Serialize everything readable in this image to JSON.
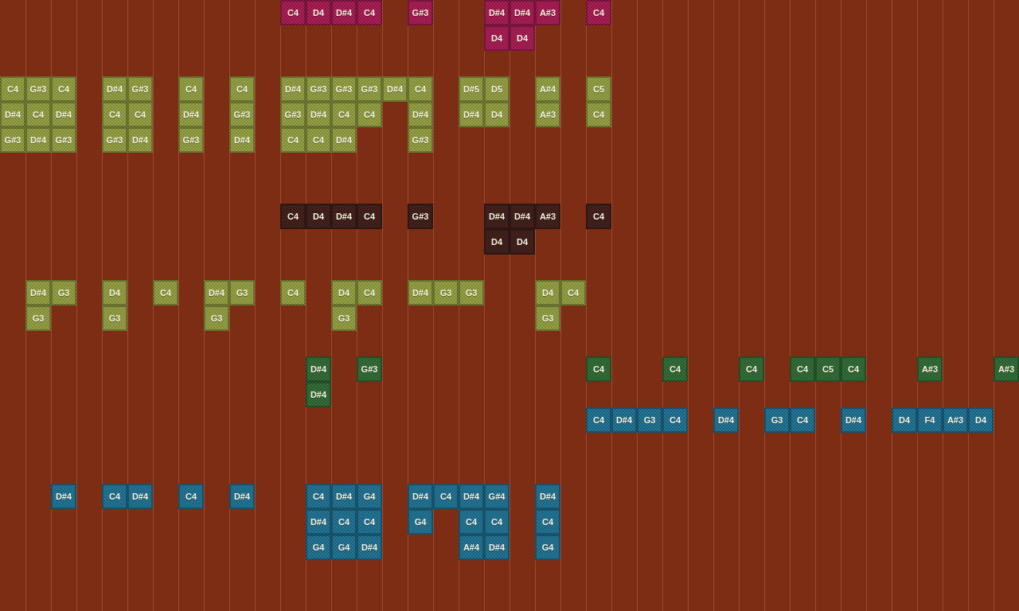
{
  "tracks": [
    {
      "color": "#a3164e",
      "steps": [
        {
          "kind": "rest"
        },
        {
          "kind": "rest"
        },
        {
          "kind": "rest"
        },
        {
          "kind": "rest"
        },
        {
          "kind": "rest"
        },
        {
          "kind": "rest"
        },
        {
          "kind": "rest"
        },
        {
          "kind": "rest"
        },
        {
          "kind": "rest"
        },
        {
          "kind": "rest"
        },
        {
          "kind": "rest"
        },
        {
          "kind": "chord",
          "notes": [
            "C4"
          ]
        },
        {
          "kind": "chord",
          "notes": [
            "D4"
          ]
        },
        {
          "kind": "chord",
          "notes": [
            "D#4"
          ]
        },
        {
          "kind": "chord",
          "notes": [
            "C4"
          ]
        },
        {
          "kind": "rest"
        },
        {
          "kind": "chord",
          "notes": [
            "G#3"
          ]
        },
        {
          "kind": "rest"
        },
        {
          "kind": "rest"
        },
        {
          "kind": "chord",
          "notes": [
            "D#4",
            "D4"
          ]
        },
        {
          "kind": "chord",
          "notes": [
            "D#4",
            "D4"
          ]
        },
        {
          "kind": "chord",
          "notes": [
            "A#3"
          ]
        },
        {
          "kind": "rest"
        },
        {
          "kind": "chord",
          "notes": [
            "C4"
          ]
        }
      ]
    },
    {
      "color": "#8e9b3d",
      "steps": [
        {
          "kind": "chord",
          "notes": [
            "C4",
            "D#4",
            "G#3"
          ]
        },
        {
          "kind": "chord",
          "notes": [
            "G#3",
            "C4",
            "D#4"
          ]
        },
        {
          "kind": "chord",
          "notes": [
            "C4",
            "D#4",
            "G#3"
          ]
        },
        {
          "kind": "rest"
        },
        {
          "kind": "chord",
          "notes": [
            "D#4",
            "C4",
            "G#3"
          ]
        },
        {
          "kind": "chord",
          "notes": [
            "G#3",
            "C4",
            "D#4"
          ]
        },
        {
          "kind": "rest"
        },
        {
          "kind": "chord",
          "notes": [
            "C4",
            "D#4",
            "G#3"
          ]
        },
        {
          "kind": "rest"
        },
        {
          "kind": "chord",
          "notes": [
            "C4",
            "G#3",
            "D#4"
          ]
        },
        {
          "kind": "rest"
        },
        {
          "kind": "chord",
          "notes": [
            "D#4",
            "G#3",
            "C4"
          ]
        },
        {
          "kind": "chord",
          "notes": [
            "G#3",
            "D#4",
            "C4"
          ]
        },
        {
          "kind": "chord",
          "notes": [
            "G#3",
            "C4",
            "D#4"
          ]
        },
        {
          "kind": "chord",
          "notes": [
            "G#3",
            "C4"
          ]
        },
        {
          "kind": "chord",
          "notes": [
            "D#4"
          ]
        },
        {
          "kind": "chord",
          "notes": [
            "C4",
            "D#4",
            "G#3"
          ]
        },
        {
          "kind": "rest"
        },
        {
          "kind": "chord",
          "notes": [
            "D#5",
            "D#4"
          ]
        },
        {
          "kind": "chord",
          "notes": [
            "D5",
            "D4"
          ]
        },
        {
          "kind": "rest"
        },
        {
          "kind": "chord",
          "notes": [
            "A#4",
            "A#3"
          ]
        },
        {
          "kind": "rest"
        },
        {
          "kind": "chord",
          "notes": [
            "C5",
            "C4"
          ]
        }
      ]
    },
    {
      "color": "#3b1914",
      "steps": [
        {
          "kind": "rest"
        },
        {
          "kind": "rest"
        },
        {
          "kind": "rest"
        },
        {
          "kind": "rest"
        },
        {
          "kind": "rest"
        },
        {
          "kind": "rest"
        },
        {
          "kind": "rest"
        },
        {
          "kind": "rest"
        },
        {
          "kind": "rest"
        },
        {
          "kind": "rest"
        },
        {
          "kind": "rest"
        },
        {
          "kind": "chord",
          "notes": [
            "C4"
          ]
        },
        {
          "kind": "chord",
          "notes": [
            "D4"
          ]
        },
        {
          "kind": "chord",
          "notes": [
            "D#4"
          ]
        },
        {
          "kind": "chord",
          "notes": [
            "C4"
          ]
        },
        {
          "kind": "rest"
        },
        {
          "kind": "chord",
          "notes": [
            "G#3"
          ]
        },
        {
          "kind": "rest"
        },
        {
          "kind": "rest"
        },
        {
          "kind": "chord",
          "notes": [
            "D#4",
            "D4"
          ]
        },
        {
          "kind": "chord",
          "notes": [
            "D#4",
            "D4"
          ]
        },
        {
          "kind": "chord",
          "notes": [
            "A#3"
          ]
        },
        {
          "kind": "rest"
        },
        {
          "kind": "chord",
          "notes": [
            "C4"
          ]
        }
      ]
    },
    {
      "color": "#8e9b3d",
      "steps": [
        {
          "kind": "rest"
        },
        {
          "kind": "chord",
          "notes": [
            "D#4",
            "G3"
          ]
        },
        {
          "kind": "chord",
          "notes": [
            "G3"
          ]
        },
        {
          "kind": "rest"
        },
        {
          "kind": "chord",
          "notes": [
            "D4",
            "G3"
          ]
        },
        {
          "kind": "rest"
        },
        {
          "kind": "chord",
          "notes": [
            "C4"
          ]
        },
        {
          "kind": "rest"
        },
        {
          "kind": "chord",
          "notes": [
            "D#4",
            "G3"
          ]
        },
        {
          "kind": "chord",
          "notes": [
            "G3"
          ]
        },
        {
          "kind": "rest"
        },
        {
          "kind": "chord",
          "notes": [
            "C4"
          ]
        },
        {
          "kind": "rest"
        },
        {
          "kind": "chord",
          "notes": [
            "D4",
            "G3"
          ]
        },
        {
          "kind": "chord",
          "notes": [
            "C4"
          ]
        },
        {
          "kind": "rest"
        },
        {
          "kind": "chord",
          "notes": [
            "D#4"
          ]
        },
        {
          "kind": "chord",
          "notes": [
            "G3"
          ]
        },
        {
          "kind": "chord",
          "notes": [
            "G3"
          ]
        },
        {
          "kind": "rest"
        },
        {
          "kind": "rest"
        },
        {
          "kind": "chord",
          "notes": [
            "D4",
            "G3"
          ]
        },
        {
          "kind": "chord",
          "notes": [
            "C4"
          ]
        }
      ]
    },
    {
      "color": "#2c6630",
      "steps": [
        {
          "kind": "rest"
        },
        {
          "kind": "rest"
        },
        {
          "kind": "rest"
        },
        {
          "kind": "rest"
        },
        {
          "kind": "rest"
        },
        {
          "kind": "rest"
        },
        {
          "kind": "rest"
        },
        {
          "kind": "rest"
        },
        {
          "kind": "rest"
        },
        {
          "kind": "rest"
        },
        {
          "kind": "rest"
        },
        {
          "kind": "rest"
        },
        {
          "kind": "chord",
          "notes": [
            "D#4",
            "D#4"
          ]
        },
        {
          "kind": "rest"
        },
        {
          "kind": "chord",
          "notes": [
            "G#3"
          ]
        },
        {
          "kind": "rest"
        },
        {
          "kind": "rest"
        },
        {
          "kind": "rest"
        },
        {
          "kind": "rest"
        },
        {
          "kind": "rest"
        },
        {
          "kind": "rest"
        },
        {
          "kind": "rest"
        },
        {
          "kind": "rest"
        },
        {
          "kind": "chord",
          "notes": [
            "C4"
          ]
        },
        {
          "kind": "rest"
        },
        {
          "kind": "rest"
        },
        {
          "kind": "chord",
          "notes": [
            "C4"
          ]
        },
        {
          "kind": "rest"
        },
        {
          "kind": "rest"
        },
        {
          "kind": "chord",
          "notes": [
            "C4"
          ]
        },
        {
          "kind": "rest"
        },
        {
          "kind": "chord",
          "notes": [
            "C4"
          ]
        },
        {
          "kind": "chord",
          "notes": [
            "C5"
          ]
        },
        {
          "kind": "chord",
          "notes": [
            "C4"
          ]
        },
        {
          "kind": "rest"
        },
        {
          "kind": "rest"
        },
        {
          "kind": "chord",
          "notes": [
            "A#3"
          ]
        },
        {
          "kind": "rest"
        },
        {
          "kind": "rest"
        },
        {
          "kind": "chord",
          "notes": [
            "A#3"
          ]
        }
      ]
    },
    {
      "color": "#1b6d8e",
      "steps": [
        {
          "kind": "rest"
        },
        {
          "kind": "rest"
        },
        {
          "kind": "rest"
        },
        {
          "kind": "rest"
        },
        {
          "kind": "rest"
        },
        {
          "kind": "rest"
        },
        {
          "kind": "rest"
        },
        {
          "kind": "rest"
        },
        {
          "kind": "rest"
        },
        {
          "kind": "rest"
        },
        {
          "kind": "rest"
        },
        {
          "kind": "rest"
        },
        {
          "kind": "rest"
        },
        {
          "kind": "rest"
        },
        {
          "kind": "rest"
        },
        {
          "kind": "rest"
        },
        {
          "kind": "rest"
        },
        {
          "kind": "rest"
        },
        {
          "kind": "rest"
        },
        {
          "kind": "rest"
        },
        {
          "kind": "rest"
        },
        {
          "kind": "rest"
        },
        {
          "kind": "rest"
        },
        {
          "kind": "chord",
          "notes": [
            "C4"
          ]
        },
        {
          "kind": "chord",
          "notes": [
            "D#4"
          ]
        },
        {
          "kind": "chord",
          "notes": [
            "G3"
          ]
        },
        {
          "kind": "chord",
          "notes": [
            "C4"
          ]
        },
        {
          "kind": "rest"
        },
        {
          "kind": "chord",
          "notes": [
            "D#4"
          ]
        },
        {
          "kind": "rest"
        },
        {
          "kind": "chord",
          "notes": [
            "G3"
          ]
        },
        {
          "kind": "chord",
          "notes": [
            "C4"
          ]
        },
        {
          "kind": "rest"
        },
        {
          "kind": "chord",
          "notes": [
            "D#4"
          ]
        },
        {
          "kind": "rest"
        },
        {
          "kind": "chord",
          "notes": [
            "D4"
          ]
        },
        {
          "kind": "chord",
          "notes": [
            "F4"
          ]
        },
        {
          "kind": "chord",
          "notes": [
            "A#3"
          ]
        },
        {
          "kind": "chord",
          "notes": [
            "D4"
          ]
        }
      ]
    },
    {
      "color": "#1b6d8e",
      "steps": [
        {
          "kind": "rest"
        },
        {
          "kind": "rest"
        },
        {
          "kind": "chord",
          "notes": [
            "D#4"
          ]
        },
        {
          "kind": "rest"
        },
        {
          "kind": "chord",
          "notes": [
            "C4"
          ]
        },
        {
          "kind": "chord",
          "notes": [
            "D#4"
          ]
        },
        {
          "kind": "rest"
        },
        {
          "kind": "chord",
          "notes": [
            "C4"
          ]
        },
        {
          "kind": "rest"
        },
        {
          "kind": "chord",
          "notes": [
            "D#4"
          ]
        },
        {
          "kind": "rest"
        },
        {
          "kind": "rest"
        },
        {
          "kind": "chord",
          "notes": [
            "C4",
            "D#4",
            "G4"
          ]
        },
        {
          "kind": "chord",
          "notes": [
            "D#4",
            "C4",
            "G4"
          ]
        },
        {
          "kind": "chord",
          "notes": [
            "G4",
            "C4",
            "D#4"
          ]
        },
        {
          "kind": "rest"
        },
        {
          "kind": "chord",
          "notes": [
            "D#4",
            "G4"
          ]
        },
        {
          "kind": "chord",
          "notes": [
            "C4"
          ]
        },
        {
          "kind": "chord",
          "notes": [
            "D#4",
            "C4",
            "A#4"
          ]
        },
        {
          "kind": "chord",
          "notes": [
            "G#4",
            "C4",
            "D#4"
          ]
        },
        {
          "kind": "rest"
        },
        {
          "kind": "chord",
          "notes": [
            "D#4",
            "C4",
            "G4"
          ]
        }
      ]
    }
  ]
}
